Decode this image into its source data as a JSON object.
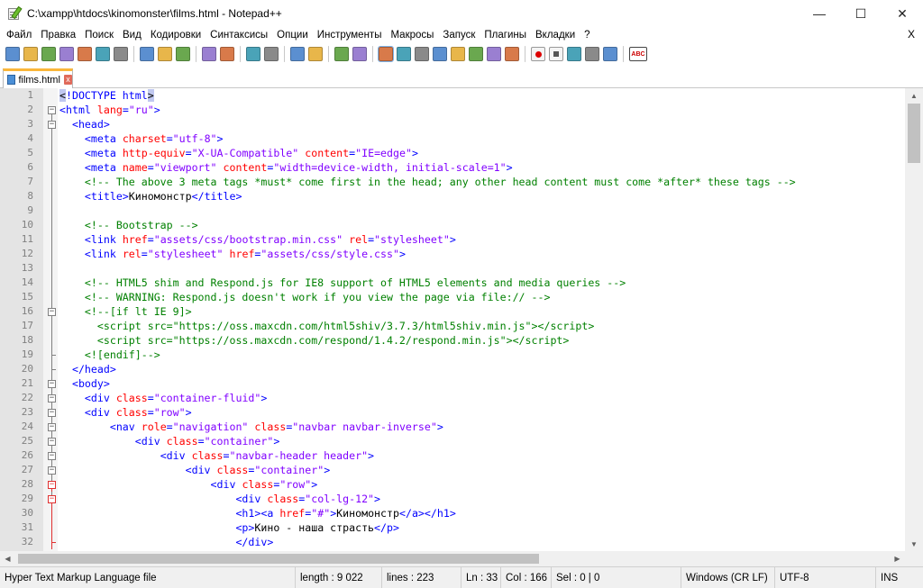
{
  "window": {
    "title": "C:\\xampp\\htdocs\\kinomonster\\films.html - Notepad++",
    "minimize_glyph": "—",
    "maximize_glyph": "☐",
    "close_glyph": "✕"
  },
  "menu": {
    "items": [
      "Файл",
      "Правка",
      "Поиск",
      "Вид",
      "Кодировки",
      "Синтаксисы",
      "Опции",
      "Инструменты",
      "Макросы",
      "Запуск",
      "Плагины",
      "Вкладки",
      "?"
    ],
    "close_glyph": "X"
  },
  "toolbar": {
    "buttons": [
      "new-file-icon",
      "open-file-icon",
      "save-icon",
      "save-all-icon",
      "close-icon",
      "close-all-icon",
      "print-icon",
      "sep",
      "cut-icon",
      "copy-icon",
      "paste-icon",
      "sep",
      "undo-icon",
      "redo-icon",
      "sep",
      "find-icon",
      "replace-icon",
      "sep",
      "zoom-in-icon",
      "zoom-out-icon",
      "sep",
      "sync-vertical-icon",
      "sync-horizontal-icon",
      "sep",
      "word-wrap-icon",
      "show-all-chars-icon",
      "indent-guide-icon",
      "user-language-icon",
      "doc-map-icon",
      "function-list-icon",
      "folder-workspace-icon",
      "monitor-icon",
      "sep",
      "record-macro-icon",
      "stop-macro-icon",
      "play-macro-icon",
      "run-macro-multiple-icon",
      "save-macro-icon",
      "sep",
      "spell-check-icon"
    ],
    "spell_check_label": "ABC"
  },
  "tabs": [
    {
      "label": "films.html",
      "close_glyph": "x"
    }
  ],
  "editor": {
    "lines": [
      {
        "n": "1",
        "indent": 0,
        "fold": "",
        "html": "<span class=\"hl\">&lt;</span><span class=\"t\">!DOCTYPE html</span><span class=\"hl\">&gt;</span>"
      },
      {
        "n": "2",
        "indent": 0,
        "fold": "minus",
        "html": "<span class=\"t\">&lt;html</span> <span class=\"a\">lang</span><span class=\"t\">=</span><span class=\"v\">\"ru\"</span><span class=\"t\">&gt;</span>"
      },
      {
        "n": "3",
        "indent": 0,
        "fold": "minus",
        "html": "  <span class=\"t\">&lt;head&gt;</span>"
      },
      {
        "n": "4",
        "indent": 0,
        "fold": "line",
        "html": "    <span class=\"t\">&lt;meta</span> <span class=\"a\">charset</span><span class=\"t\">=</span><span class=\"v\">\"utf-8\"</span><span class=\"t\">&gt;</span>"
      },
      {
        "n": "5",
        "indent": 0,
        "fold": "line",
        "html": "    <span class=\"t\">&lt;meta</span> <span class=\"a\">http-equiv</span><span class=\"t\">=</span><span class=\"v\">\"X-UA-Compatible\"</span> <span class=\"a\">content</span><span class=\"t\">=</span><span class=\"v\">\"IE=edge\"</span><span class=\"t\">&gt;</span>"
      },
      {
        "n": "6",
        "indent": 0,
        "fold": "line",
        "html": "    <span class=\"t\">&lt;meta</span> <span class=\"a\">name</span><span class=\"t\">=</span><span class=\"v\">\"viewport\"</span> <span class=\"a\">content</span><span class=\"t\">=</span><span class=\"v\">\"width=device-width, initial-scale=1\"</span><span class=\"t\">&gt;</span>"
      },
      {
        "n": "7",
        "indent": 0,
        "fold": "line",
        "html": "    <span class=\"c\">&lt;!-- The above 3 meta tags *must* come first in the head; any other head content must come *after* these tags --&gt;</span>"
      },
      {
        "n": "8",
        "indent": 0,
        "fold": "line",
        "html": "    <span class=\"t\">&lt;title&gt;</span><span class=\"txt\">Киномонстр</span><span class=\"t\">&lt;/title&gt;</span>"
      },
      {
        "n": "9",
        "indent": 0,
        "fold": "line",
        "html": ""
      },
      {
        "n": "10",
        "indent": 0,
        "fold": "line",
        "html": "    <span class=\"c\">&lt;!-- Bootstrap --&gt;</span>"
      },
      {
        "n": "11",
        "indent": 0,
        "fold": "line",
        "html": "    <span class=\"t\">&lt;link</span> <span class=\"a\">href</span><span class=\"t\">=</span><span class=\"v\">\"assets/css/bootstrap.min.css\"</span> <span class=\"a\">rel</span><span class=\"t\">=</span><span class=\"v\">\"stylesheet\"</span><span class=\"t\">&gt;</span>"
      },
      {
        "n": "12",
        "indent": 0,
        "fold": "line",
        "html": "    <span class=\"t\">&lt;link</span> <span class=\"a\">rel</span><span class=\"t\">=</span><span class=\"v\">\"stylesheet\"</span> <span class=\"a\">href</span><span class=\"t\">=</span><span class=\"v\">\"assets/css/style.css\"</span><span class=\"t\">&gt;</span>"
      },
      {
        "n": "13",
        "indent": 0,
        "fold": "line",
        "html": ""
      },
      {
        "n": "14",
        "indent": 0,
        "fold": "line",
        "html": "    <span class=\"c\">&lt;!-- HTML5 shim and Respond.js for IE8 support of HTML5 elements and media queries --&gt;</span>"
      },
      {
        "n": "15",
        "indent": 0,
        "fold": "line",
        "html": "    <span class=\"c\">&lt;!-- WARNING: Respond.js doesn't work if you view the page via file:// --&gt;</span>"
      },
      {
        "n": "16",
        "indent": 0,
        "fold": "minus",
        "html": "    <span class=\"c\">&lt;!--[if lt IE 9]&gt;</span>"
      },
      {
        "n": "17",
        "indent": 0,
        "fold": "line",
        "html": "      <span class=\"c\">&lt;script src=\"https://oss.maxcdn.com/html5shiv/3.7.3/html5shiv.min.js\"&gt;&lt;/script&gt;</span>"
      },
      {
        "n": "18",
        "indent": 0,
        "fold": "line",
        "html": "      <span class=\"c\">&lt;script src=\"https://oss.maxcdn.com/respond/1.4.2/respond.min.js\"&gt;&lt;/script&gt;</span>"
      },
      {
        "n": "19",
        "indent": 0,
        "fold": "end",
        "html": "    <span class=\"c\">&lt;![endif]--&gt;</span>"
      },
      {
        "n": "20",
        "indent": 0,
        "fold": "end",
        "html": "  <span class=\"t\">&lt;/head&gt;</span>"
      },
      {
        "n": "21",
        "indent": 0,
        "fold": "minus",
        "html": "  <span class=\"t\">&lt;body&gt;</span>"
      },
      {
        "n": "22",
        "indent": 0,
        "fold": "minus",
        "html": "    <span class=\"t\">&lt;div</span> <span class=\"a\">class</span><span class=\"t\">=</span><span class=\"v\">\"container-fluid\"</span><span class=\"t\">&gt;</span>"
      },
      {
        "n": "23",
        "indent": 0,
        "fold": "minus",
        "html": "    <span class=\"t\">&lt;div</span> <span class=\"a\">class</span><span class=\"t\">=</span><span class=\"v\">\"row\"</span><span class=\"t\">&gt;</span>"
      },
      {
        "n": "24",
        "indent": 0,
        "fold": "minus",
        "html": "        <span class=\"t\">&lt;nav</span> <span class=\"a\">role</span><span class=\"t\">=</span><span class=\"v\">\"navigation\"</span> <span class=\"a\">class</span><span class=\"t\">=</span><span class=\"v\">\"navbar navbar-inverse\"</span><span class=\"t\">&gt;</span>"
      },
      {
        "n": "25",
        "indent": 0,
        "fold": "minus",
        "html": "            <span class=\"t\">&lt;div</span> <span class=\"a\">class</span><span class=\"t\">=</span><span class=\"v\">\"container\"</span><span class=\"t\">&gt;</span>"
      },
      {
        "n": "26",
        "indent": 0,
        "fold": "minus",
        "html": "                <span class=\"t\">&lt;div</span> <span class=\"a\">class</span><span class=\"t\">=</span><span class=\"v\">\"navbar-header header\"</span><span class=\"t\">&gt;</span>"
      },
      {
        "n": "27",
        "indent": 0,
        "fold": "minus",
        "html": "                    <span class=\"t\">&lt;div</span> <span class=\"a\">class</span><span class=\"t\">=</span><span class=\"v\">\"container\"</span><span class=\"t\">&gt;</span>"
      },
      {
        "n": "28",
        "indent": 0,
        "fold": "minusred",
        "html": "                        <span class=\"t\">&lt;div</span> <span class=\"a\">class</span><span class=\"t\">=</span><span class=\"v\">\"row\"</span><span class=\"t\">&gt;</span>"
      },
      {
        "n": "29",
        "indent": 0,
        "fold": "minusred",
        "html": "                            <span class=\"t\">&lt;div</span> <span class=\"a\">class</span><span class=\"t\">=</span><span class=\"v\">\"col-lg-12\"</span><span class=\"t\">&gt;</span>"
      },
      {
        "n": "30",
        "indent": 0,
        "fold": "linered",
        "html": "                            <span class=\"t\">&lt;h1&gt;&lt;a</span> <span class=\"a\">href</span><span class=\"t\">=</span><span class=\"v\">\"#\"</span><span class=\"t\">&gt;</span><span class=\"txt\">Киномонстр</span><span class=\"t\">&lt;/a&gt;&lt;/h1&gt;</span>"
      },
      {
        "n": "31",
        "indent": 0,
        "fold": "linered",
        "html": "                            <span class=\"t\">&lt;p&gt;</span><span class=\"txt\">Кино - наша страсть</span><span class=\"t\">&lt;/p&gt;</span>"
      },
      {
        "n": "32",
        "indent": 0,
        "fold": "endred",
        "html": "                            <span class=\"t\">&lt;/div&gt;</span>"
      }
    ]
  },
  "status": {
    "file_type": "Hyper Text Markup Language file",
    "length": "length : 9 022",
    "lines": "lines : 223",
    "ln": "Ln : 33",
    "col": "Col : 166",
    "sel": "Sel : 0 | 0",
    "eol": "Windows (CR LF)",
    "encoding": "UTF-8",
    "mode": "INS"
  },
  "colors": {
    "tag": "#0000ff",
    "attribute": "#ff0000",
    "value": "#8000ff",
    "comment": "#008000",
    "tab_accent": "#fab63a",
    "fold_active": "#e03030"
  }
}
